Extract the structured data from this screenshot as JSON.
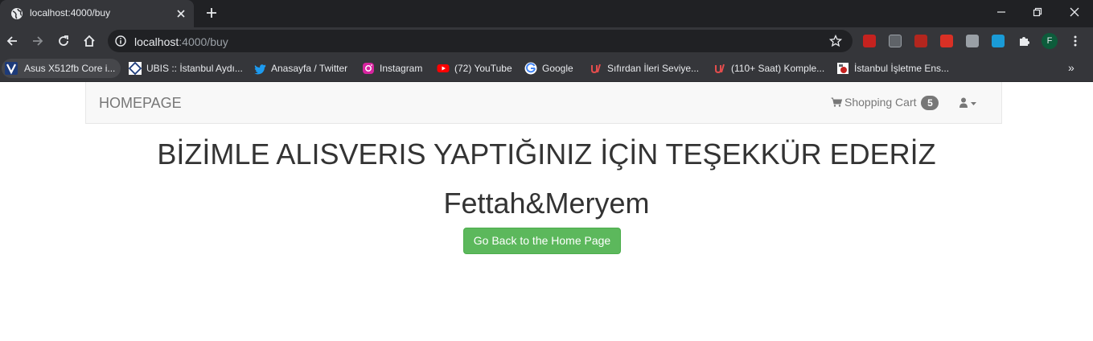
{
  "browser": {
    "tab_title": "localhost:4000/buy",
    "url_host": "localhost",
    "url_rest": ":4000/buy",
    "profile_initial": "F",
    "bookmarks": [
      {
        "label": "Asus X512fb Core i...",
        "icon": "v-logo-icon"
      },
      {
        "label": "UBIS :: İstanbul Aydı...",
        "icon": "ubis-icon"
      },
      {
        "label": "Anasayfa / Twitter",
        "icon": "twitter-icon"
      },
      {
        "label": "Instagram",
        "icon": "instagram-icon"
      },
      {
        "label": "(72) YouTube",
        "icon": "youtube-icon"
      },
      {
        "label": "Google",
        "icon": "google-icon"
      },
      {
        "label": "Sıfırdan İleri Seviye...",
        "icon": "udemy-icon"
      },
      {
        "label": "(110+ Saat) Komple...",
        "icon": "udemy-icon"
      },
      {
        "label": "İstanbul İşletme Ens...",
        "icon": "institute-icon"
      }
    ],
    "bookmarks_overflow": "»"
  },
  "navbar": {
    "brand": "HOMEPAGE",
    "cart_label": "Shopping Cart",
    "cart_count": "5"
  },
  "main": {
    "headline": "BİZİMLE ALISVERIS YAPTIĞINIZ İÇİN TEŞEKKÜR EDERİZ",
    "subheadline": "Fettah&Meryem",
    "home_button": "Go Back to the Home Page"
  },
  "colors": {
    "chrome_dark": "#202124",
    "chrome_toolbar": "#35363a",
    "navbar_bg": "#f8f8f8",
    "button_success": "#5cb85c",
    "badge_bg": "#777777",
    "text_dark": "#333333"
  }
}
